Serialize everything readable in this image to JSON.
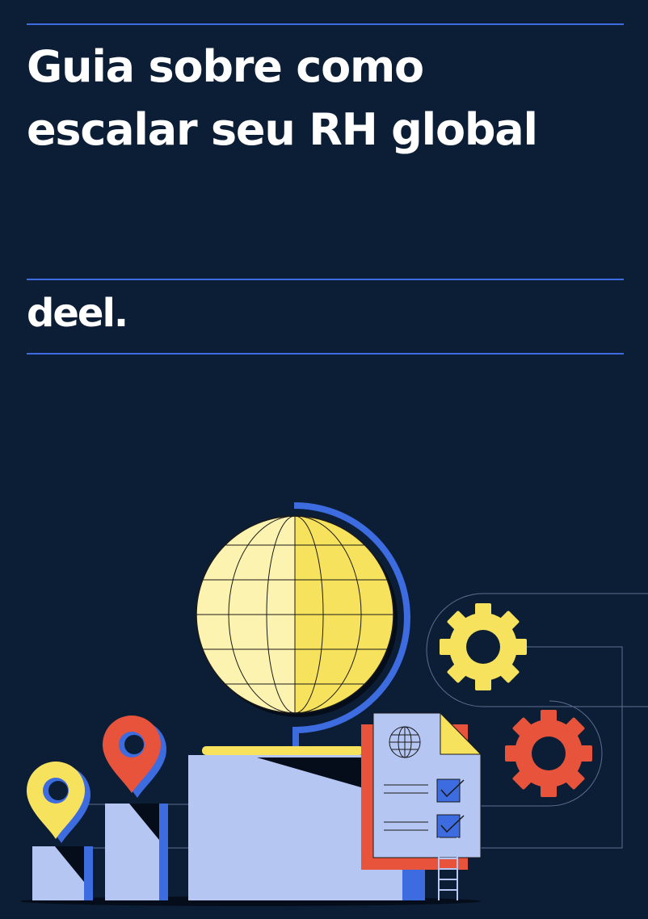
{
  "cover": {
    "title_line1": "Guia sobre como",
    "title_line2": "escalar seu RH global",
    "brand": "deel."
  },
  "colors": {
    "background": "#0c1e36",
    "rule": "#3d6be0",
    "globe_light": "#fdf3b0",
    "globe_dark": "#f7e25d",
    "box": "#b6c6f3",
    "blue": "#3d6be0",
    "red": "#e8533c",
    "yellow": "#f7e25d"
  },
  "illustration": {
    "icons": [
      "globe-icon",
      "location-pin-icon",
      "gear-icon",
      "document-icon",
      "checkbox-icon"
    ]
  }
}
